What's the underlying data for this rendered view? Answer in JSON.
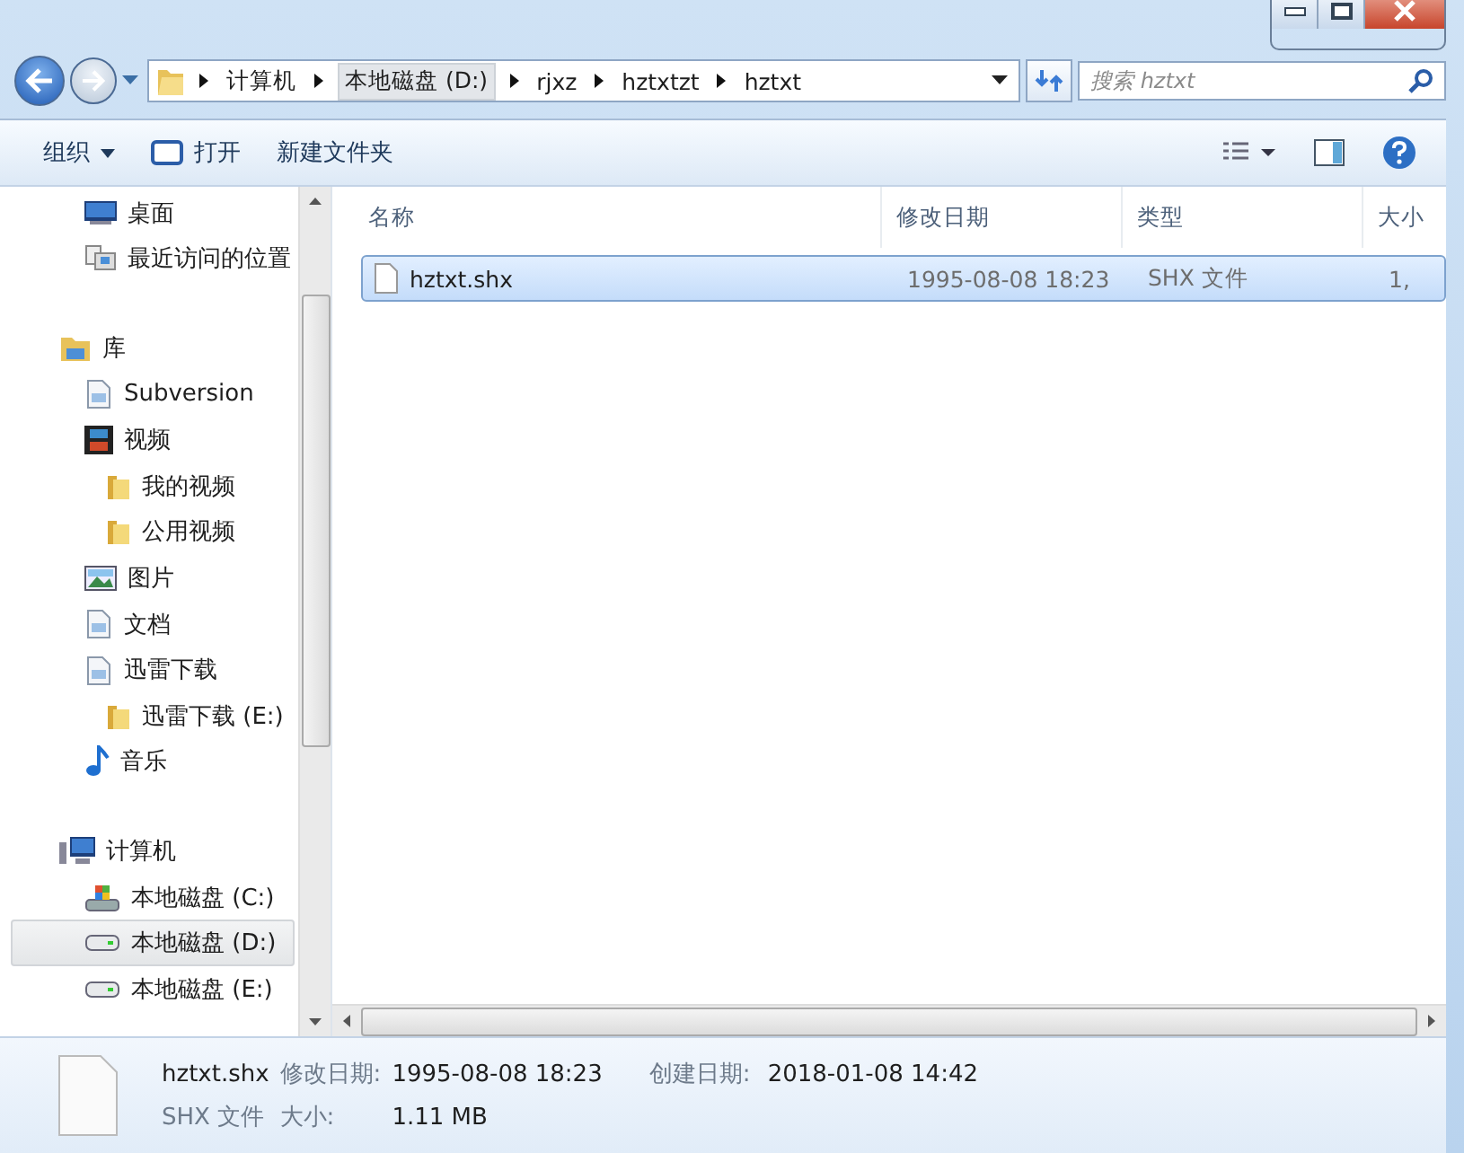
{
  "address_bar": {
    "crumbs": [
      {
        "label": "计算机",
        "selected": false
      },
      {
        "label": "本地磁盘 (D:)",
        "selected": true
      },
      {
        "label": "rjxz",
        "selected": false
      },
      {
        "label": "hztxtzt",
        "selected": false
      },
      {
        "label": "hztxt",
        "selected": false
      }
    ]
  },
  "search": {
    "placeholder": "搜索 hztxt"
  },
  "toolbar": {
    "organize": "组织",
    "open": "打开",
    "new_folder": "新建文件夹"
  },
  "sidebar": {
    "items": [
      {
        "label": "桌面",
        "selected": false
      },
      {
        "label": "最近访问的位置",
        "selected": false
      },
      {
        "label": "库",
        "selected": false,
        "children": [
          {
            "label": "Subversion",
            "selected": false
          },
          {
            "label": "视频",
            "selected": false,
            "children": [
              {
                "label": "我的视频",
                "selected": false
              },
              {
                "label": "公用视频",
                "selected": false
              }
            ]
          },
          {
            "label": "图片",
            "selected": false
          },
          {
            "label": "文档",
            "selected": false
          },
          {
            "label": "迅雷下载",
            "selected": false,
            "children": [
              {
                "label": "迅雷下载 (E:)",
                "selected": false
              }
            ]
          },
          {
            "label": "音乐",
            "selected": false
          }
        ]
      },
      {
        "label": "计算机",
        "selected": false,
        "children": [
          {
            "label": "本地磁盘 (C:)",
            "selected": false
          },
          {
            "label": "本地磁盘 (D:)",
            "selected": true
          },
          {
            "label": "本地磁盘 (E:)",
            "selected": false
          }
        ]
      }
    ]
  },
  "table": {
    "columns": [
      "名称",
      "修改日期",
      "类型",
      "大小"
    ],
    "rows": [
      {
        "name": "hztxt.shx",
        "modified": "1995-08-08 18:23",
        "type": "SHX 文件",
        "size": "1,",
        "selected": true
      }
    ]
  },
  "details": {
    "name": "hztxt.shx",
    "type": "SHX 文件",
    "modified_label": "修改日期:",
    "modified": "1995-08-08 18:23",
    "created_label": "创建日期:",
    "created": "2018-01-08 14:42",
    "size_label": "大小:",
    "size": "1.11 MB"
  }
}
